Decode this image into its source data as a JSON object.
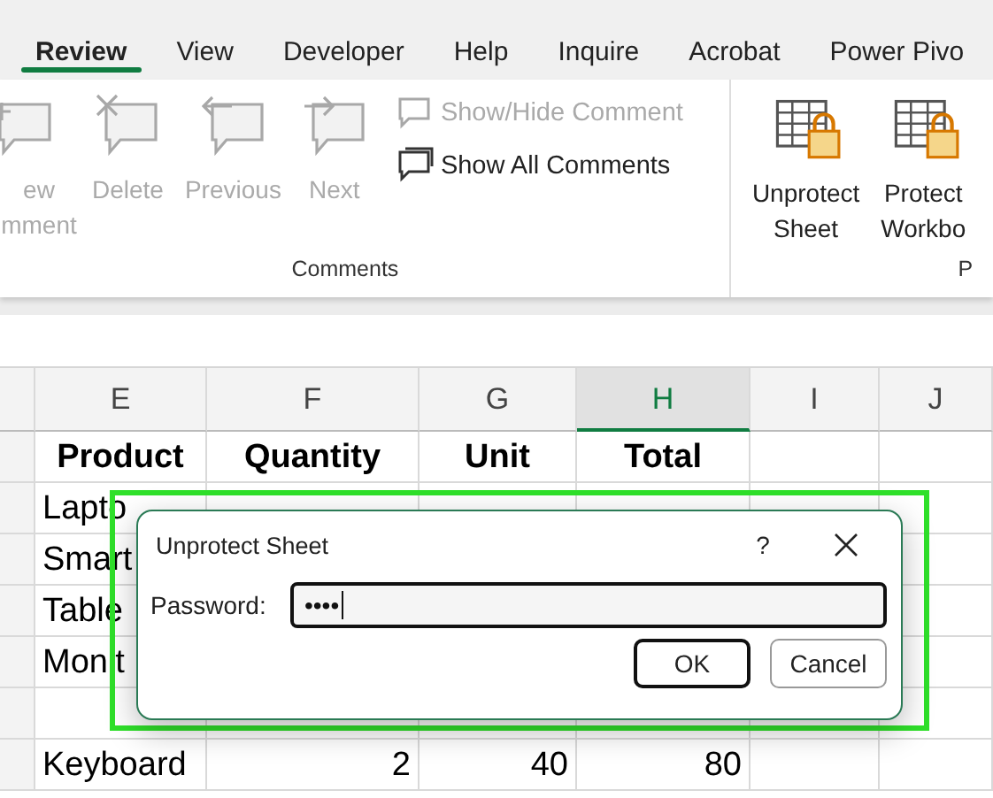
{
  "tabs": [
    {
      "label": "Review",
      "selected": true
    },
    {
      "label": "View",
      "selected": false
    },
    {
      "label": "Developer",
      "selected": false
    },
    {
      "label": "Help",
      "selected": false
    },
    {
      "label": "Inquire",
      "selected": false
    },
    {
      "label": "Acrobat",
      "selected": false
    },
    {
      "label": "Power Pivo",
      "selected": false
    }
  ],
  "ribbon": {
    "groups": [
      {
        "label": "Comments",
        "items": [
          {
            "kind": "comment",
            "lines": [
              "ew",
              "mment"
            ],
            "disabled": true
          },
          {
            "kind": "comment",
            "lines": [
              "Delete"
            ],
            "disabled": true
          },
          {
            "kind": "comment",
            "lines": [
              "Previous"
            ],
            "disabled": true
          },
          {
            "kind": "comment",
            "lines": [
              "Next"
            ],
            "disabled": true
          },
          {
            "kind": "stack",
            "entries": [
              {
                "label": "Show/Hide Comment",
                "disabled": true
              },
              {
                "label": "Show All Comments",
                "disabled": false
              }
            ]
          }
        ]
      },
      {
        "label": "P",
        "items": [
          {
            "kind": "protect",
            "lines": [
              "Unprotect",
              "Sheet"
            ],
            "disabled": false
          },
          {
            "kind": "protect",
            "lines": [
              "Protect",
              "Workbo"
            ],
            "disabled": false
          }
        ]
      }
    ]
  },
  "sheet": {
    "columns": [
      {
        "label": "E",
        "selected": false
      },
      {
        "label": "F",
        "selected": false
      },
      {
        "label": "G",
        "selected": false
      },
      {
        "label": "H",
        "selected": true
      },
      {
        "label": "I",
        "selected": false
      },
      {
        "label": "J",
        "selected": false
      }
    ],
    "header_row": [
      "Product",
      "Quantity",
      "Unit",
      "Total"
    ],
    "rows": [
      {
        "cells": [
          "Lapto"
        ]
      },
      {
        "cells": [
          "Smart"
        ]
      },
      {
        "cells": [
          "Table"
        ]
      },
      {
        "cells": [
          "Monit"
        ]
      },
      {},
      {
        "cells": [
          "Keyboard",
          "2",
          "40",
          "80"
        ]
      }
    ]
  },
  "dialog": {
    "title": "Unprotect Sheet",
    "help": "?",
    "field_label": "Password:",
    "value": "••••",
    "buttons": [
      {
        "label": "OK",
        "default": true
      },
      {
        "label": "Cancel",
        "default": false
      }
    ]
  }
}
